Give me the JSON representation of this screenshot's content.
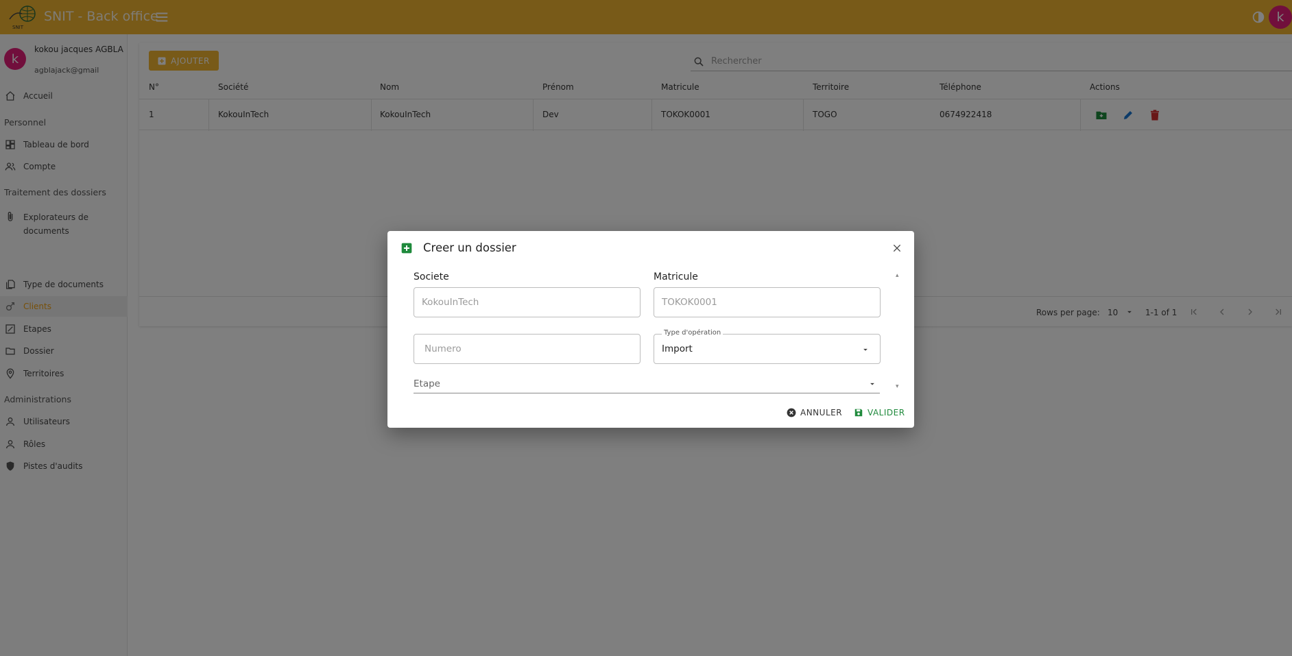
{
  "app": {
    "title": "SNIT - Back office",
    "logo_text": "SNIT",
    "avatar_letter": "k"
  },
  "user": {
    "avatar_letter": "k",
    "name": "kokou jacques AGBLA",
    "email": "agblajack@gmail"
  },
  "nav": {
    "home": "Accueil",
    "section_personnel": "Personnel",
    "dashboard": "Tableau de bord",
    "account": "Compte",
    "section_processing": "Traitement des dossiers",
    "explorer": "Explorateurs de documents",
    "doc_types": "Type de documents",
    "clients": "Clients",
    "steps": "Etapes",
    "folder": "Dossier",
    "territories": "Territoires",
    "section_admin": "Administrations",
    "users": "Utilisateurs",
    "roles": "Rôles",
    "audit": "Pistes d'audits"
  },
  "toolbar": {
    "add_label": "AJOUTER",
    "search_placeholder": "Rechercher"
  },
  "table": {
    "headers": [
      "N°",
      "Société",
      "Nom",
      "Prénom",
      "Matricule",
      "Territoire",
      "Téléphone",
      "Actions"
    ],
    "rows": [
      [
        "1",
        "KokouInTech",
        "KokouInTech",
        "Dev",
        "TOKOK0001",
        "TOGO",
        "0674922418"
      ]
    ]
  },
  "pagination": {
    "rows_per_page_label": "Rows per page:",
    "rows_per_page": "10",
    "range": "1-1 of 1"
  },
  "dialog": {
    "title": "Creer un dossier",
    "societe_label": "Societe",
    "societe_value": "KokouInTech",
    "matricule_label": "Matricule",
    "matricule_value": "TOKOK0001",
    "numero_placeholder": "Numero",
    "type_label": "Type d'opération",
    "type_value": "Import",
    "etape_placeholder": "Etape",
    "cancel_label": "ANNULER",
    "ok_label": "VALIDER"
  },
  "colors": {
    "appbar": "#f0b431",
    "accent": "#f0a012",
    "avatar": "#e31e78",
    "green": "#1f8a3c",
    "blue": "#1976d2",
    "red": "#d32f2f"
  }
}
